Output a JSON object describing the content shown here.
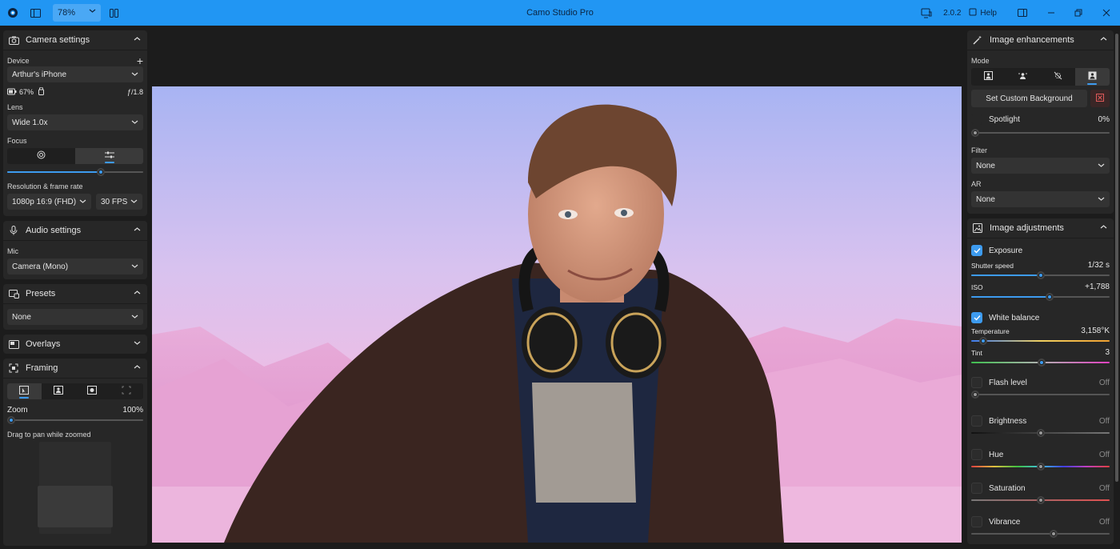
{
  "window": {
    "title": "Camo Studio Pro",
    "zoom": "78%",
    "version": "2.0.2",
    "help": "Help"
  },
  "left": {
    "camera": {
      "title": "Camera settings",
      "device_label": "Device",
      "device": "Arthur's iPhone",
      "battery": "67%",
      "aperture": "ƒ/1.8",
      "lens_label": "Lens",
      "lens": "Wide 1.0x",
      "focus_label": "Focus",
      "focus_value": 0.7,
      "res_label": "Resolution & frame rate",
      "resolution": "1080p 16:9 (FHD)",
      "fps": "30 FPS"
    },
    "audio": {
      "title": "Audio settings",
      "mic_label": "Mic",
      "mic": "Camera (Mono)"
    },
    "presets": {
      "title": "Presets",
      "value": "None"
    },
    "overlays": {
      "title": "Overlays"
    },
    "framing": {
      "title": "Framing",
      "zoom_label": "Zoom",
      "zoom_value": "100%",
      "zoom_level": 0,
      "pan_hint": "Drag to pan while zoomed"
    }
  },
  "right": {
    "enhance": {
      "title": "Image enhancements",
      "mode_label": "Mode",
      "custom_bg": "Set Custom Background",
      "spotlight_label": "Spotlight",
      "spotlight_value": "0%",
      "spotlight_level": 0,
      "filter_label": "Filter",
      "filter": "None",
      "ar_label": "AR",
      "ar": "None"
    },
    "adjust": {
      "title": "Image adjustments",
      "exposure": "Exposure",
      "shutter_label": "Shutter speed",
      "shutter_value": "1/32 s",
      "shutter_level": 0.5,
      "iso_label": "ISO",
      "iso_value": "+1,788",
      "iso_level": 0.57,
      "wb": "White balance",
      "temp_label": "Temperature",
      "temp_value": "3,158°K",
      "temp_level": 0.06,
      "tint_label": "Tint",
      "tint_value": "3",
      "tint_level": 0.51,
      "flash_label": "Flash level",
      "flash_value": "Off",
      "flash_level": 0,
      "bright_label": "Brightness",
      "bright_value": "Off",
      "bright_level": 0.5,
      "hue_label": "Hue",
      "hue_value": "Off",
      "hue_level": 0.5,
      "sat_label": "Saturation",
      "sat_value": "Off",
      "sat_level": 0.5,
      "vib_label": "Vibrance",
      "vib_value": "Off",
      "vib_level": 0.6
    }
  },
  "colors": {
    "accent": "#3d9bef",
    "titlebar": "#2196f3",
    "panel": "#272727",
    "bg": "#1c1c1c"
  }
}
